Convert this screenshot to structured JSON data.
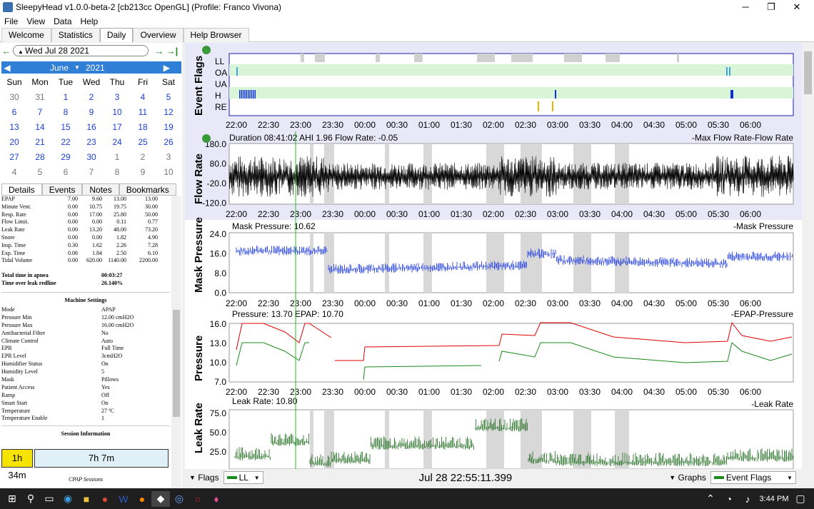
{
  "window": {
    "title": "SleepyHead v1.0.0-beta-2 [cb213cc OpenGL] (Profile: Franco Vivona)",
    "min": "─",
    "max": "❐",
    "close": "✕"
  },
  "menu": [
    "File",
    "View",
    "Data",
    "Help"
  ],
  "tabs": [
    "Welcome",
    "Statistics",
    "Daily",
    "Overview",
    "Help Browser"
  ],
  "datebar": {
    "date": "Wed Jul 28 2021"
  },
  "calendar": {
    "month": "June",
    "year": "2021",
    "days": [
      "Sun",
      "Mon",
      "Tue",
      "Wed",
      "Thu",
      "Fri",
      "Sat"
    ],
    "weeks": [
      [
        "30",
        "31",
        "1",
        "2",
        "3",
        "4",
        "5"
      ],
      [
        "6",
        "7",
        "8",
        "9",
        "10",
        "11",
        "12"
      ],
      [
        "13",
        "14",
        "15",
        "16",
        "17",
        "18",
        "19"
      ],
      [
        "20",
        "21",
        "22",
        "23",
        "24",
        "25",
        "26"
      ],
      [
        "27",
        "28",
        "29",
        "30",
        "1",
        "2",
        "3"
      ],
      [
        "4",
        "5",
        "6",
        "7",
        "8",
        "9",
        "10"
      ]
    ]
  },
  "detail_tabs": [
    "Details",
    "Events",
    "Notes",
    "Bookmarks"
  ],
  "stats": [
    [
      "EPAP",
      "7.00",
      "9.60",
      "13.00",
      "13.00"
    ],
    [
      "Minute Vent.",
      "0.00",
      "10.75",
      "19.75",
      "30.00"
    ],
    [
      "Resp. Rate",
      "0.00",
      "17.00",
      "25.80",
      "50.00"
    ],
    [
      "Flow Limit.",
      "0.00",
      "0.00",
      "0.11",
      "0.77"
    ],
    [
      "Leak Rate",
      "0.00",
      "13.20",
      "48.00",
      "73.20"
    ],
    [
      "Snore",
      "0.00",
      "0.00",
      "1.82",
      "4.90"
    ],
    [
      "Insp. Time",
      "0.30",
      "1.62",
      "2.26",
      "7.28"
    ],
    [
      "Exp. Time",
      "0.06",
      "1.84",
      "2.50",
      "6.10"
    ],
    [
      "Tidal Volume",
      "0.00",
      "620.00",
      "1140.00",
      "2200.00"
    ]
  ],
  "apnea": [
    {
      "k": "Total time in apnea",
      "v": "00:03:27"
    },
    {
      "k": "Time over leak redline",
      "v": "26.140%"
    }
  ],
  "machine_title": "Machine Settings",
  "machine": [
    {
      "k": "Mode",
      "v": "APAP"
    },
    {
      "k": "Pressure Min",
      "v": "12.00 cmH2O"
    },
    {
      "k": "Pressure Max",
      "v": "16.00 cmH2O"
    },
    {
      "k": "Antibacterial Filter",
      "v": "No"
    },
    {
      "k": "Climate Control",
      "v": "Auto"
    },
    {
      "k": "EPR",
      "v": "Full Time"
    },
    {
      "k": "EPR Level",
      "v": "3cmH2O"
    },
    {
      "k": "Humidifier Status",
      "v": "On"
    },
    {
      "k": "Humidity Level",
      "v": "5"
    },
    {
      "k": "Mask",
      "v": "Pillows"
    },
    {
      "k": "Patient Access",
      "v": "Yes"
    },
    {
      "k": "Ramp",
      "v": "Off"
    },
    {
      "k": "Smart Start",
      "v": "On"
    },
    {
      "k": "Temperature",
      "v": "27 ºC"
    },
    {
      "k": "Temperature Enable",
      "v": "1"
    }
  ],
  "session_title": "Session Information",
  "session": {
    "short": "1h 34m",
    "long": "7h 7m"
  },
  "cpap_label": "CPAP Sessions",
  "time_ticks": [
    "22:00",
    "22:30",
    "23:00",
    "23:30",
    "00:00",
    "00:30",
    "01:00",
    "01:30",
    "02:00",
    "02:30",
    "03:00",
    "03:30",
    "04:00",
    "04:30",
    "05:00",
    "05:30",
    "06:00"
  ],
  "graphs": {
    "flags": {
      "title": "Event Flags",
      "rows": [
        "LL",
        "OA",
        "UA",
        "H",
        "RE"
      ]
    },
    "flow": {
      "title": "Flow Rate",
      "header": "Duration 08:41:02 AHI 1.96 Flow Rate: -0.05",
      "legend": "-Max Flow Rate-Flow Rate",
      "yticks": [
        "180.0",
        "80.0",
        "-20.0",
        "-120.0"
      ]
    },
    "mask": {
      "title": "Mask Pressure",
      "header": "Mask Pressure: 10.62",
      "legend": "-Mask Pressure",
      "yticks": [
        "24.0",
        "16.0",
        "8.0",
        "0.0"
      ]
    },
    "pressure": {
      "title": "Pressure",
      "header": "Pressure: 13.70 EPAP: 10.70",
      "legend": "-EPAP-Pressure",
      "yticks": [
        "16.0",
        "13.0",
        "10.0",
        "7.0"
      ]
    },
    "leak": {
      "title": "Leak Rate",
      "header": "Leak Rate: 10.80",
      "legend": "-Leak Rate",
      "yticks": [
        "75.0",
        "50.0",
        "25.0"
      ]
    }
  },
  "bottom": {
    "flags": "Flags",
    "ll": "LL",
    "timestamp": "Jul 28 22:55:11.399",
    "graphs": "Graphs",
    "events": "Event Flags"
  },
  "taskbar": {
    "time": "3:44 PM"
  },
  "colors": {
    "accent": "#2f7fd6",
    "epap": "#1a8a1a",
    "pressure": "#e00000",
    "leak": "#1a6a1a",
    "mask": "#1030e0",
    "flags_bg": "#d8f5d8"
  }
}
